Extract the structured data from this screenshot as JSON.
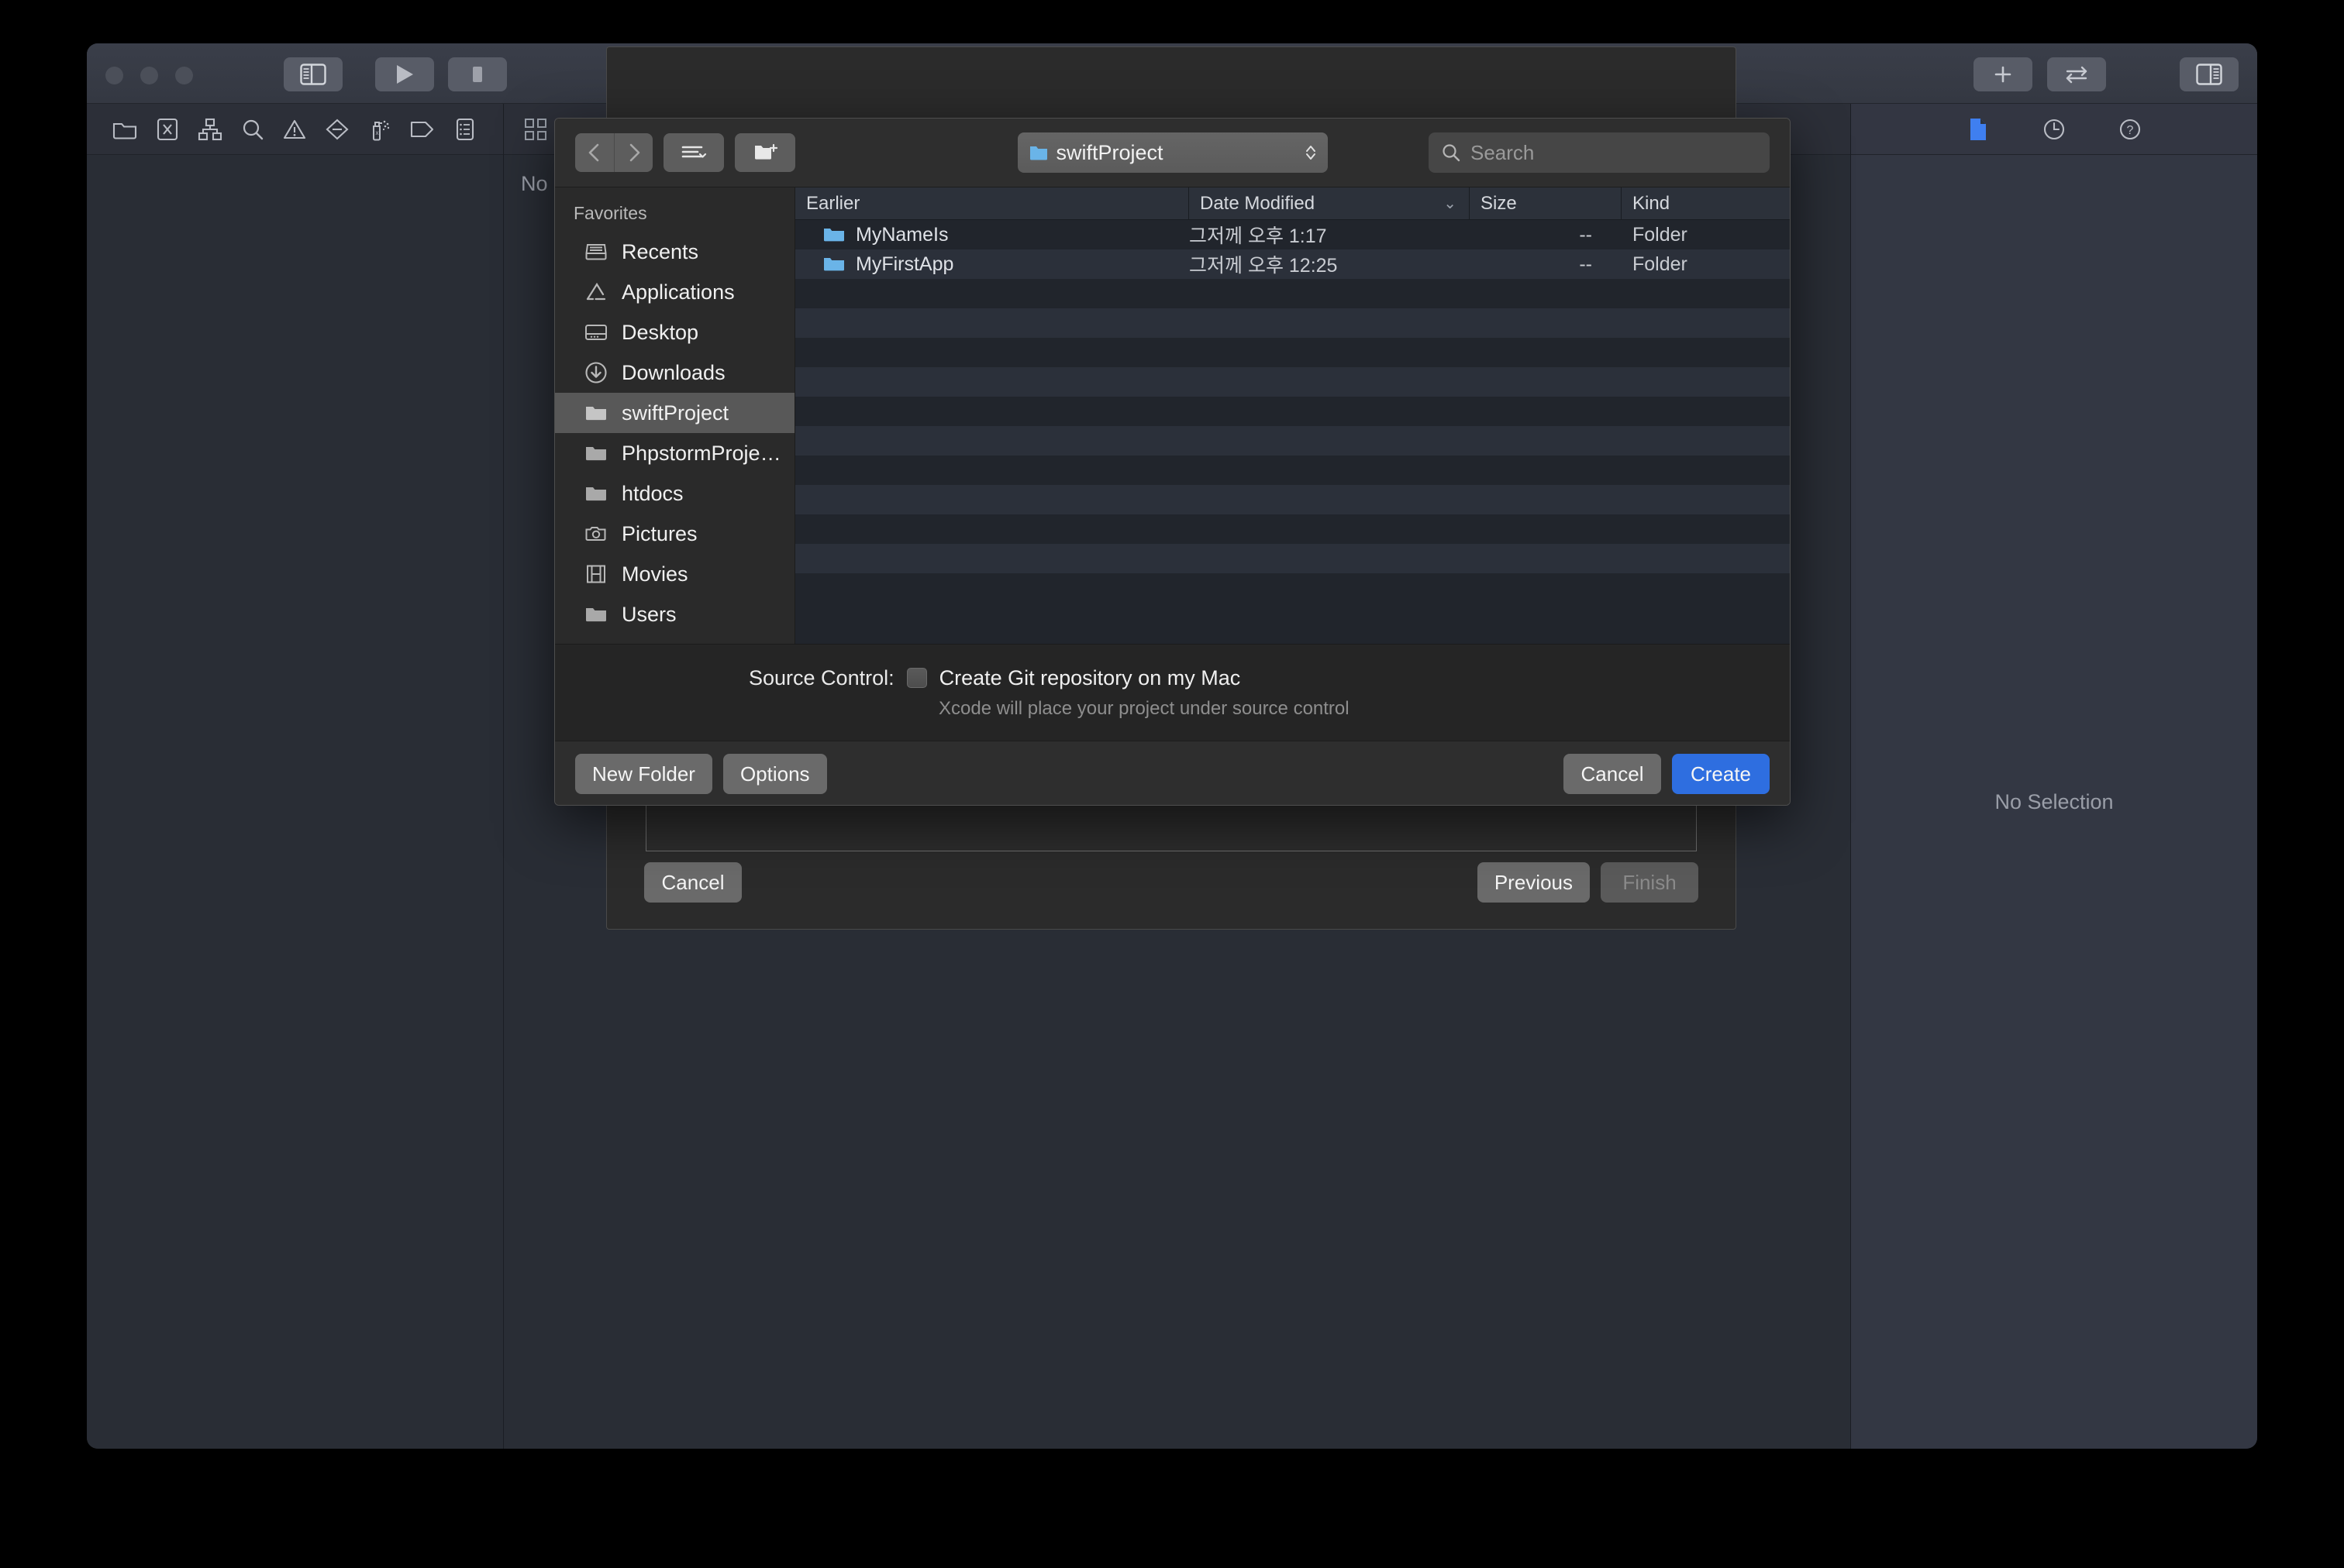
{
  "window": {
    "traffic_lights": [
      "close",
      "minimize",
      "zoom"
    ],
    "toolbar_left": [
      {
        "name": "navigator-toggle",
        "icon": "sidebar-left-icon"
      },
      {
        "name": "run-button",
        "icon": "play-icon"
      },
      {
        "name": "stop-button",
        "icon": "stop-icon"
      }
    ],
    "toolbar_right": [
      {
        "name": "add-button",
        "icon": "plus-icon"
      },
      {
        "name": "swap-button",
        "icon": "arrows-swap-icon"
      },
      {
        "name": "inspector-toggle",
        "icon": "sidebar-right-icon"
      }
    ],
    "activity_bar_text": ""
  },
  "navigator": {
    "icons": [
      "folder-icon",
      "x-square-icon",
      "hierarchy-icon",
      "search-icon",
      "warning-triangle-icon",
      "breakpoint-diamond-icon",
      "spray-bottle-icon",
      "tag-icon",
      "report-list-icon"
    ]
  },
  "editor": {
    "toolbar_icons": [
      "grid-modules-icon"
    ],
    "empty_text": "No S"
  },
  "inspector": {
    "toolbar_icons": [
      "file-document-icon",
      "clock-history-icon",
      "help-question-icon"
    ],
    "empty_text": "No Selection"
  },
  "wizard": {
    "cancel_label": "Cancel",
    "previous_label": "Previous",
    "finish_label": "Finish"
  },
  "dialog": {
    "toolbar": {
      "back_icon": "chevron-left-icon",
      "forward_icon": "chevron-right-icon",
      "view_options_icon": "list-view-icon",
      "new_folder_icon": "new-folder-icon",
      "path_label": "swiftProject",
      "path_icon": "folder-blue-icon",
      "stepper_icon": "chevron-updown-icon"
    },
    "search": {
      "placeholder": "Search",
      "value": "",
      "icon": "search-icon"
    },
    "sidebar": {
      "section_title": "Favorites",
      "items": [
        {
          "label": "Recents",
          "icon": "recents-icon",
          "selected": false
        },
        {
          "label": "Applications",
          "icon": "applications-icon",
          "selected": false
        },
        {
          "label": "Desktop",
          "icon": "desktop-icon",
          "selected": false
        },
        {
          "label": "Downloads",
          "icon": "downloads-icon",
          "selected": false
        },
        {
          "label": "swiftProject",
          "icon": "folder-icon",
          "selected": true
        },
        {
          "label": "PhpstormProje…",
          "icon": "folder-icon",
          "selected": false
        },
        {
          "label": "htdocs",
          "icon": "folder-icon",
          "selected": false
        },
        {
          "label": "Pictures",
          "icon": "pictures-icon",
          "selected": false
        },
        {
          "label": "Movies",
          "icon": "movies-icon",
          "selected": false
        },
        {
          "label": "Users",
          "icon": "folder-icon",
          "selected": false
        }
      ]
    },
    "file_list": {
      "columns": [
        {
          "label": "Earlier",
          "sorted": false
        },
        {
          "label": "Date Modified",
          "sorted": true,
          "sort_dir": "desc"
        },
        {
          "label": "Size",
          "sorted": false
        },
        {
          "label": "Kind",
          "sorted": false
        }
      ],
      "rows": [
        {
          "name": "MyNameIs",
          "date": "그저께 오후 1:17",
          "size": "--",
          "kind": "Folder"
        },
        {
          "name": "MyFirstApp",
          "date": "그저께 오후 12:25",
          "size": "--",
          "kind": "Folder"
        }
      ],
      "empty_row_count": 11
    },
    "source_control": {
      "label": "Source Control:",
      "checkbox_label": "Create Git repository on my Mac",
      "checked": false,
      "hint": "Xcode will place your project under source control"
    },
    "footer": {
      "new_folder_label": "New Folder",
      "options_label": "Options",
      "cancel_label": "Cancel",
      "create_label": "Create"
    }
  },
  "colors": {
    "accent_blue": "#2e6ee0",
    "folder_blue": "#6ab4e8",
    "window_bg": "#292d35",
    "dialog_bg": "#2e2e2e",
    "list_row_odd": "#21252c",
    "list_row_even": "#2b303a"
  }
}
